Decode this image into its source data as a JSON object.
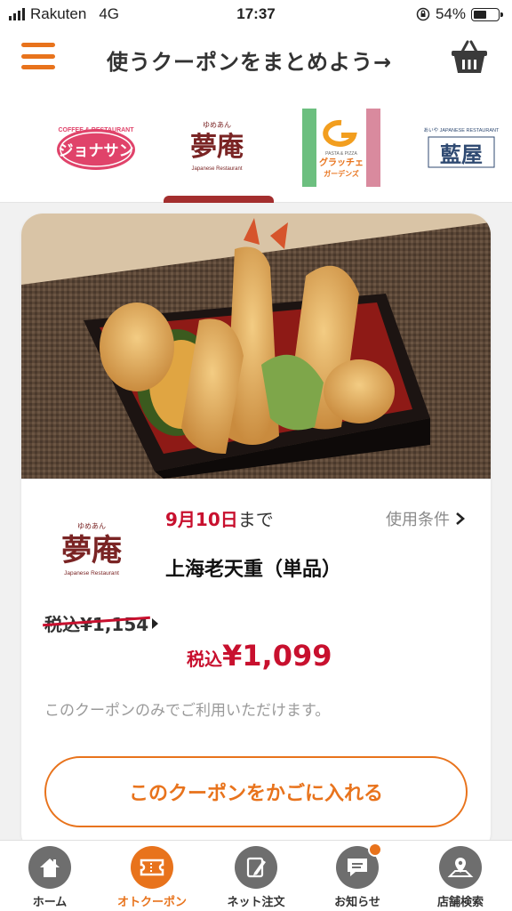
{
  "status_bar": {
    "carrier": "Rakuten",
    "network": "4G",
    "time": "17:37",
    "battery": "54%",
    "battery_level": 0.54
  },
  "header": {
    "title": "使うクーポンをまとめよう→",
    "menu_icon": "hamburger-icon",
    "basket_icon": "basket-icon"
  },
  "brands": [
    {
      "name": "ジョナサン",
      "sub": "COFFEE & RESTAURANT"
    },
    {
      "name": "夢庵",
      "ruby": "ゆめあん",
      "sub": "Japanese Restaurant",
      "selected": true
    },
    {
      "name": "グラッチェ",
      "top": "PASTA & PIZZA",
      "sub": "ガーデンズ"
    },
    {
      "name": "藍屋",
      "top": "あいや JAPANESE RESTAURANT"
    }
  ],
  "coupon": {
    "logo": {
      "name": "夢庵",
      "ruby": "ゆめあん",
      "sub": "Japanese Restaurant"
    },
    "date_red": "9月10日",
    "date_rest": "まで",
    "terms_label": "使用条件",
    "product_name": "上海老天重（単品）",
    "old_price": "税込¥1,154",
    "new_price_tax": "税込",
    "new_price_amount": "¥1,099",
    "note": "このクーポンのみでご利用いただけます。",
    "cta_label": "このクーポンをかごに入れる"
  },
  "tabs": [
    {
      "label": "ホーム",
      "icon": "home-icon"
    },
    {
      "label": "オトクーポン",
      "icon": "ticket-icon",
      "active": true
    },
    {
      "label": "ネット注文",
      "icon": "pencil-icon"
    },
    {
      "label": "お知らせ",
      "icon": "message-icon",
      "badge": true
    },
    {
      "label": "店舗検索",
      "icon": "map-pin-icon"
    }
  ],
  "colors": {
    "accent": "#e8731c",
    "price_red": "#c8102e",
    "brand_maroon": "#a32e2e"
  }
}
